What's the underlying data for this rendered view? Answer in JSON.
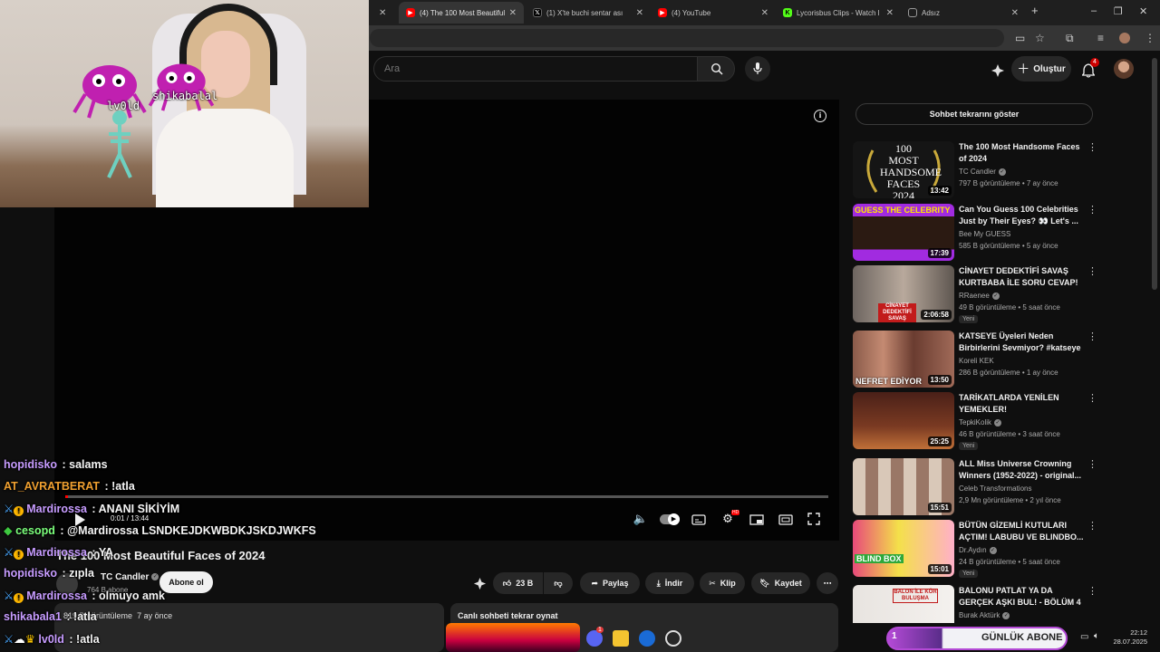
{
  "browser": {
    "tabs": [
      {
        "label": "(4) The 100 Most Beautiful Faces of 2024",
        "active": true,
        "favicon": "youtube-icon"
      },
      {
        "label": "(1) X'te buchi sentar ası",
        "active": false,
        "favicon": "x-icon"
      },
      {
        "label": "(4) YouTube",
        "active": false,
        "favicon": "youtube-icon"
      },
      {
        "label": "Lycorisbus Clips - Watch l",
        "active": false,
        "favicon": "kick-icon"
      },
      {
        "label": "Adsız",
        "active": false,
        "favicon": "blank-icon"
      }
    ],
    "new_tab": "+",
    "window_controls": {
      "minimize": "–",
      "restore": "❐",
      "close": "✕"
    }
  },
  "youtube": {
    "search_placeholder": "Ara",
    "create_label": "Oluştur",
    "notification_count": "4",
    "brand_red": "#ff0000"
  },
  "player": {
    "time": "0:01 / 13:44",
    "progress": 0.0012
  },
  "video": {
    "title": "The 100 Most Beautiful Faces of 2024",
    "channel": "TC Candler",
    "subscribers": "764 B abone",
    "subscribe_label": "Abone ol",
    "likes": "23 B",
    "share_label": "Paylaş",
    "download_label": "İndir",
    "clip_label": "Klip",
    "save_label": "Kaydet",
    "views": "819 B görüntüleme",
    "age": "7 ay önce",
    "chat_replay_label": "Canlı sohbeti tekrar oynat"
  },
  "sidebar": {
    "chat_replay_button": "Sohbet tekrarını göster",
    "recommendations": [
      {
        "title": "The 100 Most Handsome Faces of 2024",
        "channel": "TC Candler",
        "verified": true,
        "meta": "797 B görüntüleme • 7 ay önce",
        "duration": "13:42",
        "badge": "",
        "thumb_text": "100 MOST HANDSOME FACES 2024"
      },
      {
        "title": "Can You Guess 100 Celebrities Just by Their Eyes? 👀 Let's ...",
        "channel": "Bee My GUESS",
        "verified": false,
        "meta": "585 B görüntüleme • 5 ay önce",
        "duration": "17:39",
        "badge": "",
        "thumb_text": "GUESS THE CELEBRITY"
      },
      {
        "title": "CİNAYET DEDEKTİFİ SAVAŞ KURTBABA İLE SORU CEVAP!",
        "channel": "RRaenee",
        "verified": true,
        "meta": "49 B görüntüleme • 5 saat önce",
        "duration": "2:06:58",
        "badge": "Yeni",
        "thumb_text": "CİNAYET DEDEKTİFİ SAVAŞ KURTBA"
      },
      {
        "title": "KATSEYE Üyeleri Neden Birbirlerini Sevmiyor? #katseye",
        "channel": "Koreli KEK",
        "verified": false,
        "meta": "286 B görüntüleme • 1 ay önce",
        "duration": "13:50",
        "badge": "",
        "thumb_text": "NEFRET EDİYOR"
      },
      {
        "title": "TARİKATLARDA YENİLEN YEMEKLER!",
        "channel": "TepkiKolik",
        "verified": true,
        "meta": "46 B görüntüleme • 3 saat önce",
        "duration": "25:25",
        "badge": "Yeni",
        "thumb_text": ""
      },
      {
        "title": "ALL Miss Universe Crowning Winners (1952-2022) - original...",
        "channel": "Celeb Transformations",
        "verified": false,
        "meta": "2,9 Mn görüntüleme • 2 yıl önce",
        "duration": "15:51",
        "badge": "",
        "thumb_text": ""
      },
      {
        "title": "BÜTÜN GİZEMLİ KUTULARI AÇTIM! LABUBU VE BLINDBO...",
        "channel": "Dr.Aydın",
        "verified": true,
        "meta": "24 B görüntüleme • 5 saat önce",
        "duration": "15:01",
        "badge": "Yeni",
        "thumb_text": "BLIND BOX"
      },
      {
        "title": "BALONU PATLAT YA DA GERÇEK AŞKI BUL! - BÖLÜM 4",
        "channel": "Burak Aktürk",
        "verified": true,
        "meta": "",
        "duration": "",
        "badge": "",
        "thumb_text": "BALON İLE KÖR BULUŞMA"
      }
    ]
  },
  "overlay": {
    "webcam_names": [
      "lv0ld",
      "shikabalal"
    ],
    "chat": [
      {
        "user": "hopidisko",
        "message": "salams",
        "color": "#c79cff",
        "badges": []
      },
      {
        "user": "AT_AVRATBERAT",
        "message": "!atla",
        "color": "#f0a030",
        "badges": []
      },
      {
        "user": "Mardirossa",
        "message": "ANANI SİKİYİM",
        "color": "#c79cff",
        "badges": [
          "sword",
          "warning"
        ]
      },
      {
        "user": "cesopd",
        "message": "@Mardirossa LSNDKEJDKWBDKJSKDJWKFS",
        "color": "#7cff7c",
        "badges": [
          "diamond"
        ]
      },
      {
        "user": "Mardirossa",
        "message": "YA",
        "color": "#c79cff",
        "badges": [
          "sword",
          "warning"
        ]
      },
      {
        "user": "hopidisko",
        "message": "zıpla",
        "color": "#c79cff",
        "badges": []
      },
      {
        "user": "Mardirossa",
        "message": "olmuyo amk",
        "color": "#c79cff",
        "badges": [
          "sword",
          "warning"
        ]
      },
      {
        "user": "shikabala1",
        "message": "!atla",
        "color": "#c79cff",
        "badges": []
      },
      {
        "user": "lv0ld",
        "message": "!atla",
        "color": "#c79cff",
        "badges": [
          "sword",
          "cloud",
          "crown"
        ]
      }
    ],
    "goal": {
      "number": "1",
      "label": "GÜNLÜK ABONE"
    }
  },
  "taskbar": {
    "time": "22:12",
    "date": "28.07.2025",
    "discord_badge": "1"
  }
}
